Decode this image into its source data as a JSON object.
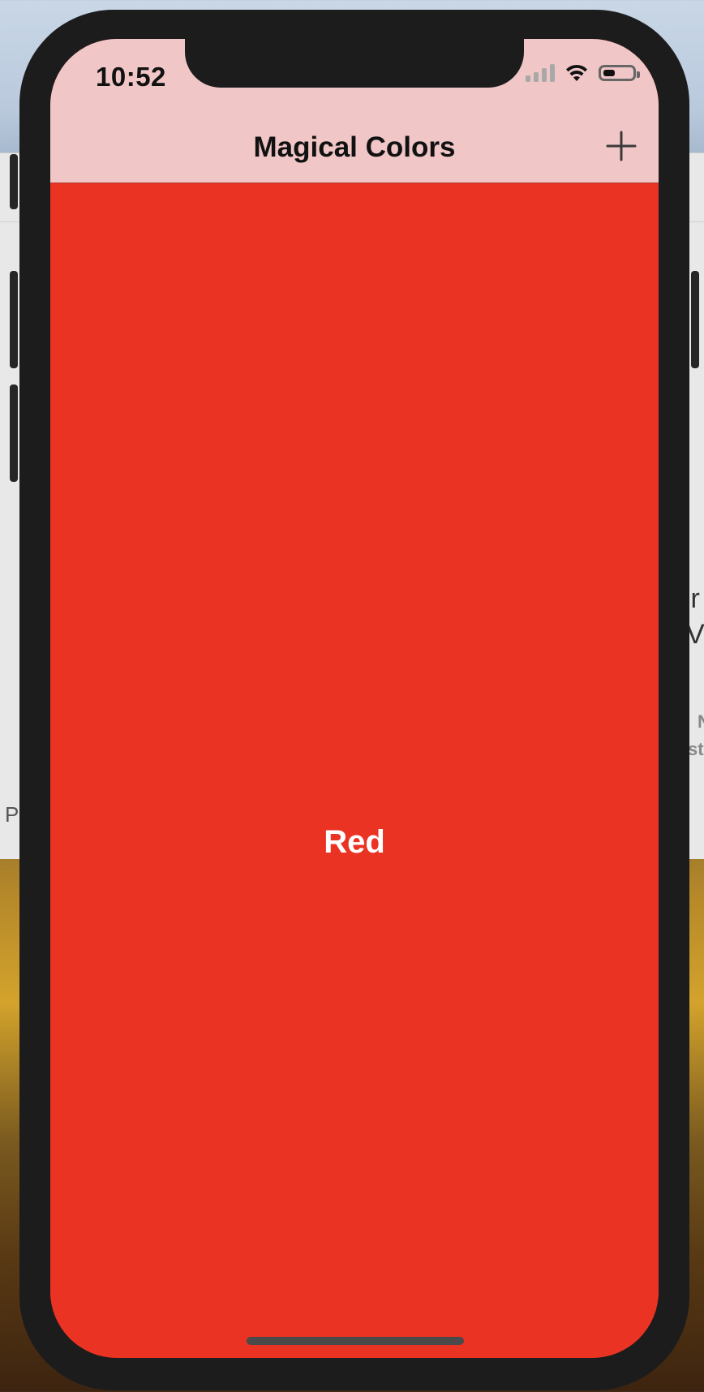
{
  "status_bar": {
    "time": "10:52",
    "signal_icon": "cellular-signal-icon",
    "wifi_icon": "wifi-icon",
    "battery_icon": "battery-icon",
    "battery_level": 0.4
  },
  "nav": {
    "title": "Magical Colors",
    "add_icon": "plus-icon"
  },
  "color_panel": {
    "name": "Red",
    "background": "#EA3323"
  },
  "background_window": {
    "right_text_1": "ir",
    "right_text_2": "V",
    "right_text_3": "N",
    "right_text_4": "st",
    "left_text": "P"
  },
  "colors": {
    "nav_bar": "#F0C6C6",
    "phone_frame": "#1C1C1D"
  }
}
